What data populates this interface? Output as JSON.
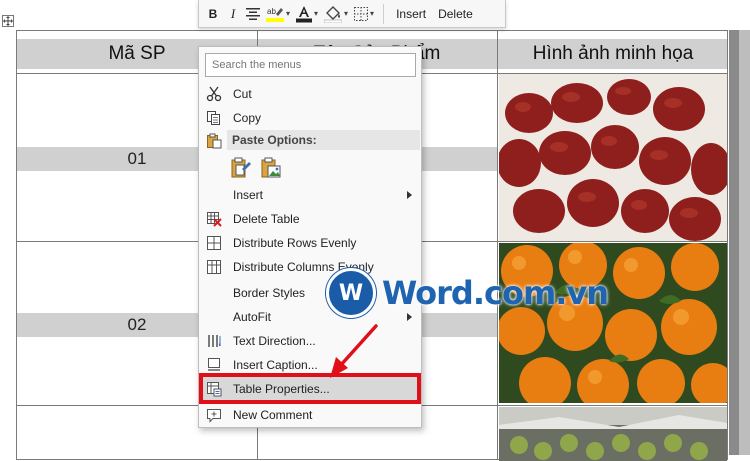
{
  "table": {
    "headers": [
      "Mã SP",
      "Tên Sản Phẩm",
      "Hình ảnh minh họa"
    ],
    "rows": [
      {
        "code": "01"
      },
      {
        "code": "02"
      }
    ]
  },
  "toolbar": {
    "bold": "B",
    "italic": "I",
    "insert_label": "Insert",
    "delete_label": "Delete"
  },
  "menu": {
    "search_placeholder": "Search the menus",
    "cut": "Cut",
    "copy": "Copy",
    "paste_options": "Paste Options:",
    "insert": "Insert",
    "delete_table": "Delete Table",
    "distribute_rows": "Distribute Rows Evenly",
    "distribute_columns": "Distribute Columns Evenly",
    "border_styles": "Border Styles",
    "autofit": "AutoFit",
    "text_direction": "Text Direction...",
    "insert_caption": "Insert Caption...",
    "table_properties": "Table Properties...",
    "new_comment": "New Comment"
  },
  "watermark": {
    "logo_letter": "W",
    "text": "Word.com.vn"
  },
  "colors": {
    "highlight_box": "#e0101a",
    "brand_blue": "#1e64b0",
    "header_gray": "#d0d0d0"
  }
}
